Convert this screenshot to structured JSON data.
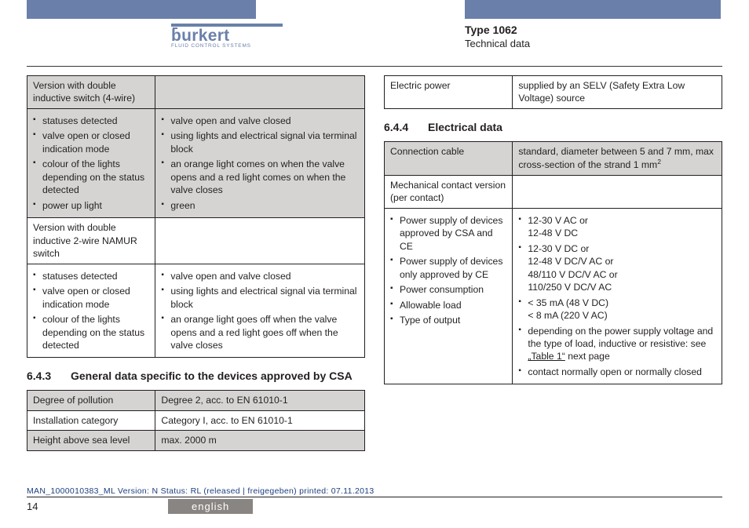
{
  "brand": {
    "name": "burkert",
    "tagline": "FLUID CONTROL SYSTEMS"
  },
  "header": {
    "type": "Type 1062",
    "section": "Technical data"
  },
  "footer": {
    "docmeta": "MAN_1000010383_ML  Version: N Status: RL (released | freigegeben)  printed: 07.11.2013",
    "page": "14",
    "language": "english"
  },
  "sections": {
    "s643": {
      "num": "6.4.3",
      "title": "General data specific to the devices approved by CSA"
    },
    "s644": {
      "num": "6.4.4",
      "title": "Electrical data"
    }
  },
  "tableA": {
    "group1_header": "Version with double inductive switch (4-wire)",
    "g1_l1": "statuses detected",
    "g1_r1": "valve open and valve closed",
    "g1_l2": "valve open or closed indication mode",
    "g1_r2": "using lights and electrical signal via terminal block",
    "g1_l3": "colour of the lights depending on the status detected",
    "g1_r3": "an orange light comes on when the valve opens and a red light comes on when the valve closes",
    "g1_l4": "power up light",
    "g1_r4": "green",
    "group2_header": "Version with double inductive 2-wire NAMUR switch",
    "g2_l1": "statuses detected",
    "g2_r1": "valve open and valve closed",
    "g2_l2": "valve open or closed indication mode",
    "g2_r2": "using lights and electrical signal via terminal block",
    "g2_l3": "colour of the lights depending on the status detected",
    "g2_r3": "an orange light goes off when the valve opens and a red light goes off when the valve closes"
  },
  "tableB": {
    "r1_l": "Degree of pollution",
    "r1_r": "Degree 2, acc. to EN 61010-1",
    "r2_l": "Installation category",
    "r2_r": "Category I, acc. to EN 61010-1",
    "r3_l": "Height above sea level",
    "r3_r": "max. 2000 m"
  },
  "tableC": {
    "r1_l": "Electric power",
    "r1_r": "supplied by an SELV (Safety Extra Low Voltage) source"
  },
  "tableD": {
    "r1_l": "Connection cable",
    "r1_r_a": "standard, diameter between 5 and 7 mm, max cross-section of the strand 1 mm",
    "r1_r_sup": "2",
    "g_header": "Mechanical contact version (per contact)",
    "l1": "Power supply of devices approved by CSA and CE",
    "r_1a": "12-30 V AC or",
    "r_1b": "12-48 V DC",
    "l2": "Power supply of devices only approved by CE",
    "r_2a": "12-30 V DC or",
    "r_2b": "12-48 V DC/V AC or",
    "r_2c": "48/110 V DC/V AC or",
    "r_2d": "110/250 V DC/V AC",
    "l3": "Power consumption",
    "r_3a": "< 35 mA (48 V DC)",
    "r_3b": "< 8 mA (220 V AC)",
    "l4": "Allowable load",
    "r_4a": "depending on the power supply voltage and the type of load, inductive or resistive: see ",
    "r_4link": "„Table 1“",
    "r_4b": " next page",
    "l5": "Type of output",
    "r_5": "contact normally open or normally closed"
  }
}
